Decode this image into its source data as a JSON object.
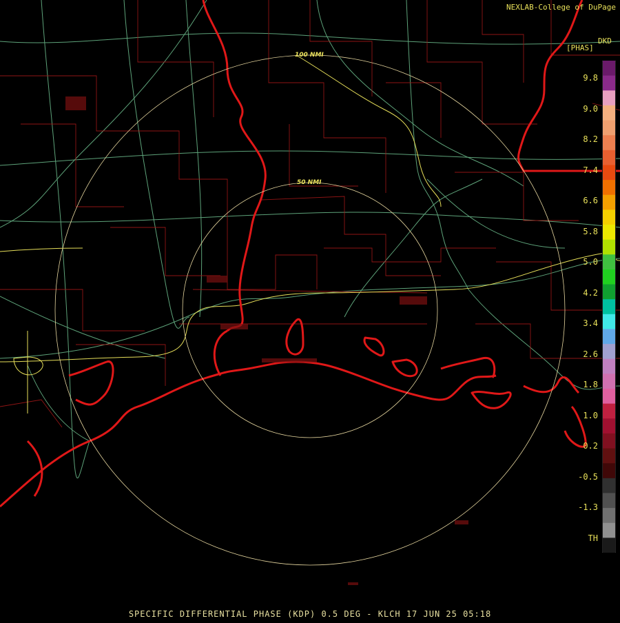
{
  "header": {
    "credit": "NEXLAB-College of DuPage",
    "product_code": "DKD",
    "units": "[PHAS]"
  },
  "rings": [
    {
      "label": "100 NMI"
    },
    {
      "label": "50 NMI"
    }
  ],
  "legend": {
    "ticks": [
      "9.8",
      "9.0",
      "8.2",
      "7.4",
      "6.6",
      "5.8",
      "5.0",
      "4.2",
      "3.4",
      "2.6",
      "1.8",
      "1.0",
      "0.2",
      "-0.5",
      "-1.3",
      "TH"
    ],
    "colors": [
      "#6a1a6a",
      "#8a2a8a",
      "#e8a0c0",
      "#f4b080",
      "#f0a070",
      "#ee8050",
      "#e86030",
      "#e84a10",
      "#f07000",
      "#f4a000",
      "#f4d000",
      "#ece800",
      "#b0e000",
      "#40c040",
      "#20d020",
      "#10a030",
      "#00c0a0",
      "#40e8e8",
      "#60a8e8",
      "#a0a0d0",
      "#c080c0",
      "#d070b0",
      "#e060a0",
      "#c02040",
      "#a01030",
      "#801020",
      "#601010",
      "#400808",
      "#303030",
      "#505050",
      "#707070",
      "#909090",
      "#1a1a1a"
    ]
  },
  "footer": "SPECIFIC DIFFERENTIAL PHASE (KDP) 0.5 DEG - KLCH 17 JUN 25 05:18"
}
